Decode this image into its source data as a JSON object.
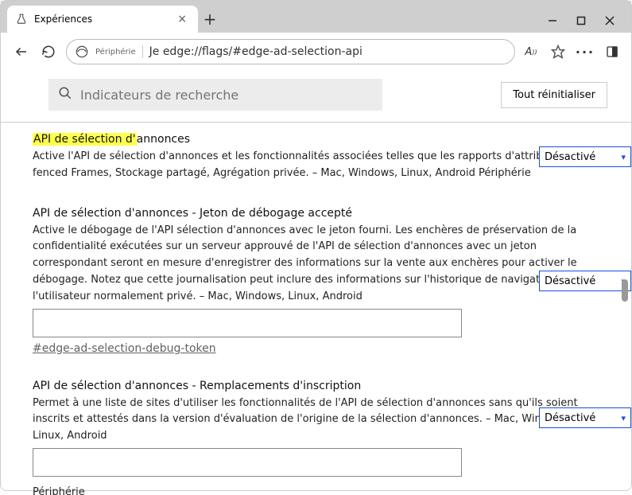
{
  "tab": {
    "title": "Expériences"
  },
  "addr": {
    "label": "Périphérie",
    "prefix": "Je",
    "url": "edge://flags/#edge-ad-selection-api"
  },
  "page": {
    "search_placeholder": "Indicateurs de recherche",
    "reset_label": "Tout réinitialiser"
  },
  "select_options": {
    "disabled": "Désactivé"
  },
  "flags": [
    {
      "title_hl": "API de sélection d'",
      "title_rest": "annonces",
      "desc": "Active l'API de sélection d'annonces et les fonctionnalités associées telles que les rapports d'attribution, fenced Frames, Stockage partagé, Agrégation privée. – Mac, Windows, Linux, Android Périphérie"
    },
    {
      "title": "API de sélection d'annonces - Jeton de débogage accepté",
      "desc": "Active le débogage de l'API sélection d'annonces avec le jeton fourni. Les enchères de préservation de la confidentialité exécutées sur un serveur approuvé de l'API de sélection d'annonces avec un jeton correspondant seront en mesure d'enregistrer des informations sur la vente aux enchères pour activer le débogage. Notez que cette journalisation peut inclure des informations sur l'historique de navigation de l'utilisateur normalement privé. – Mac, Windows, Linux, Android",
      "link": "#edge-ad-selection-debug-token"
    },
    {
      "title": "API de sélection d'annonces - Remplacements d'inscription",
      "desc": "Permet à une liste de sites d'utiliser les fonctionnalités de l'API de sélection d'annonces sans qu'ils soient inscrits et attestés dans la version d'évaluation de l'origine de la sélection d'annonces. – Mac, Windows, Linux, Android",
      "footer": "Périphérie"
    }
  ]
}
